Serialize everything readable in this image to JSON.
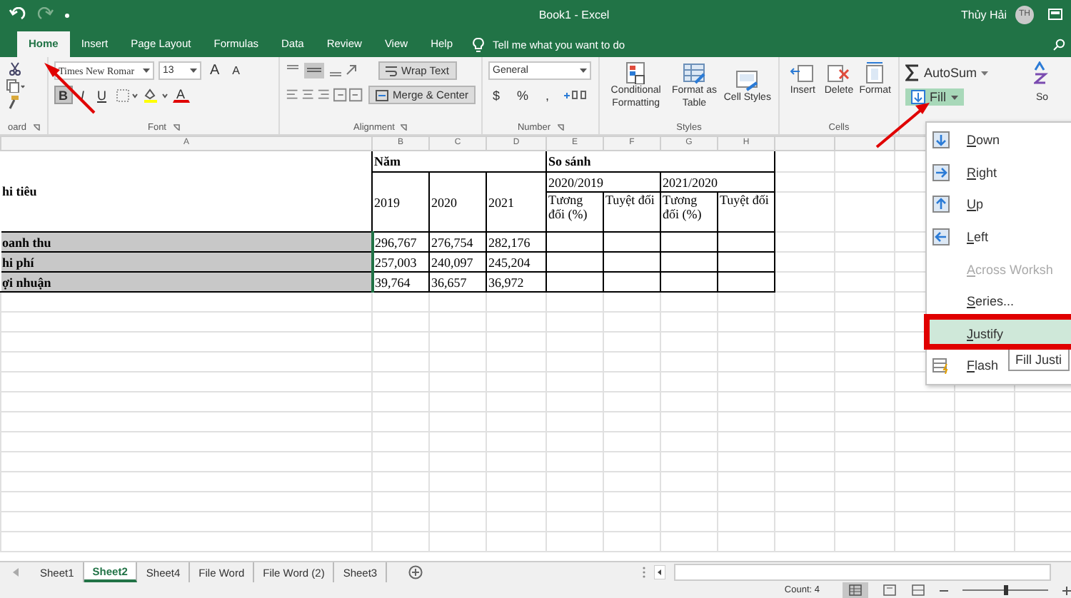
{
  "window": {
    "title": "Book1 - Excel",
    "user": "Thủy Hải",
    "avatar": "TH"
  },
  "tabs": [
    {
      "label": "Home",
      "selected": true
    },
    {
      "label": "Insert",
      "selected": false
    },
    {
      "label": "Page Layout",
      "selected": false
    },
    {
      "label": "Formulas",
      "selected": false
    },
    {
      "label": "Data",
      "selected": false
    },
    {
      "label": "Review",
      "selected": false
    },
    {
      "label": "View",
      "selected": false
    },
    {
      "label": "Help",
      "selected": false
    }
  ],
  "tell_me": "Tell me what you want to do",
  "ribbon": {
    "clipboard": {
      "label": "oard"
    },
    "font": {
      "name": "Times New Romar",
      "size": "13",
      "grow": "A",
      "shrink": "A",
      "format_buttons": [
        {
          "label": "B",
          "on": true
        },
        {
          "label": "I",
          "on": false
        },
        {
          "label": "U",
          "on": false
        }
      ],
      "color_letter": "A",
      "label": "Font"
    },
    "alignment": {
      "wrap": "Wrap Text",
      "merge": "Merge & Center",
      "label": "Alignment"
    },
    "number": {
      "format": "General",
      "symbols": [
        "$",
        "%",
        ","
      ],
      "label": "Number"
    },
    "styles": {
      "buttons": [
        "Conditional Formatting",
        "Format as Table",
        "Cell Styles"
      ],
      "label": "Styles"
    },
    "cells": {
      "buttons": [
        "Insert",
        "Delete",
        "Format"
      ],
      "label": "Cells"
    },
    "editing": {
      "autosum": "AutoSum",
      "fill": "Fill",
      "fill_open": true,
      "sort": "So"
    }
  },
  "columns": [
    "A",
    "B",
    "C",
    "D",
    "E",
    "F",
    "G",
    "H"
  ],
  "header_rows": [
    [
      {
        "text": "hi tiêu",
        "rowspan": 3,
        "bold": true
      },
      {
        "text": "Năm",
        "colspan": 3,
        "bold": true
      },
      {
        "text": "So sánh",
        "colspan": 4,
        "bold": true
      }
    ],
    [
      {
        "text": "2019",
        "rowspan": 2,
        "bold": false
      },
      {
        "text": "2020",
        "rowspan": 2,
        "bold": false
      },
      {
        "text": "2021",
        "rowspan": 2,
        "bold": false
      },
      {
        "text": "2020/2019",
        "colspan": 2,
        "bold": false
      },
      {
        "text": "2021/2020",
        "colspan": 2,
        "bold": false
      }
    ],
    [
      {
        "text": "Tương đối (%)",
        "bold": false
      },
      {
        "text": "Tuyệt đối",
        "bold": false
      },
      {
        "text": "Tương đối (%)",
        "bold": false
      },
      {
        "text": "Tuyệt đối",
        "bold": false
      }
    ]
  ],
  "rows": [
    {
      "label": "oanh thu",
      "selected": true,
      "values": [
        "296,767",
        "276,754",
        "282,176"
      ]
    },
    {
      "label": "hi phí",
      "selected": true,
      "values": [
        "257,003",
        "240,097",
        "245,204"
      ]
    },
    {
      "label": "ợi nhuận",
      "selected": true,
      "values": [
        "39,764",
        "36,657",
        "36,972"
      ]
    }
  ],
  "fill_menu": [
    {
      "label": "Down",
      "kind": "down",
      "disabled": false,
      "selected": false
    },
    {
      "label": "Right",
      "kind": "right",
      "disabled": false,
      "selected": false
    },
    {
      "label": "Up",
      "kind": "up",
      "disabled": false,
      "selected": false
    },
    {
      "label": "Left",
      "kind": "left",
      "disabled": false,
      "selected": false
    },
    {
      "label": "Across Worksh",
      "kind": "none",
      "disabled": true,
      "selected": false
    },
    {
      "label": "Series...",
      "kind": "none",
      "disabled": false,
      "selected": false
    },
    {
      "label": "Justify",
      "kind": "none",
      "disabled": false,
      "selected": true
    },
    {
      "label": "Flash",
      "kind": "flash",
      "disabled": false,
      "selected": false
    }
  ],
  "tooltip": "Fill Justi",
  "sheet_tabs": [
    {
      "label": "Sheet1",
      "selected": false
    },
    {
      "label": "Sheet2",
      "selected": true
    },
    {
      "label": "Sheet4",
      "selected": false
    },
    {
      "label": "File Word",
      "selected": false
    },
    {
      "label": "File Word (2)",
      "selected": false
    },
    {
      "label": "Sheet3",
      "selected": false
    }
  ],
  "status_bar": {
    "count": "Count: 4",
    "zoom": {
      "level": 0.5
    }
  }
}
